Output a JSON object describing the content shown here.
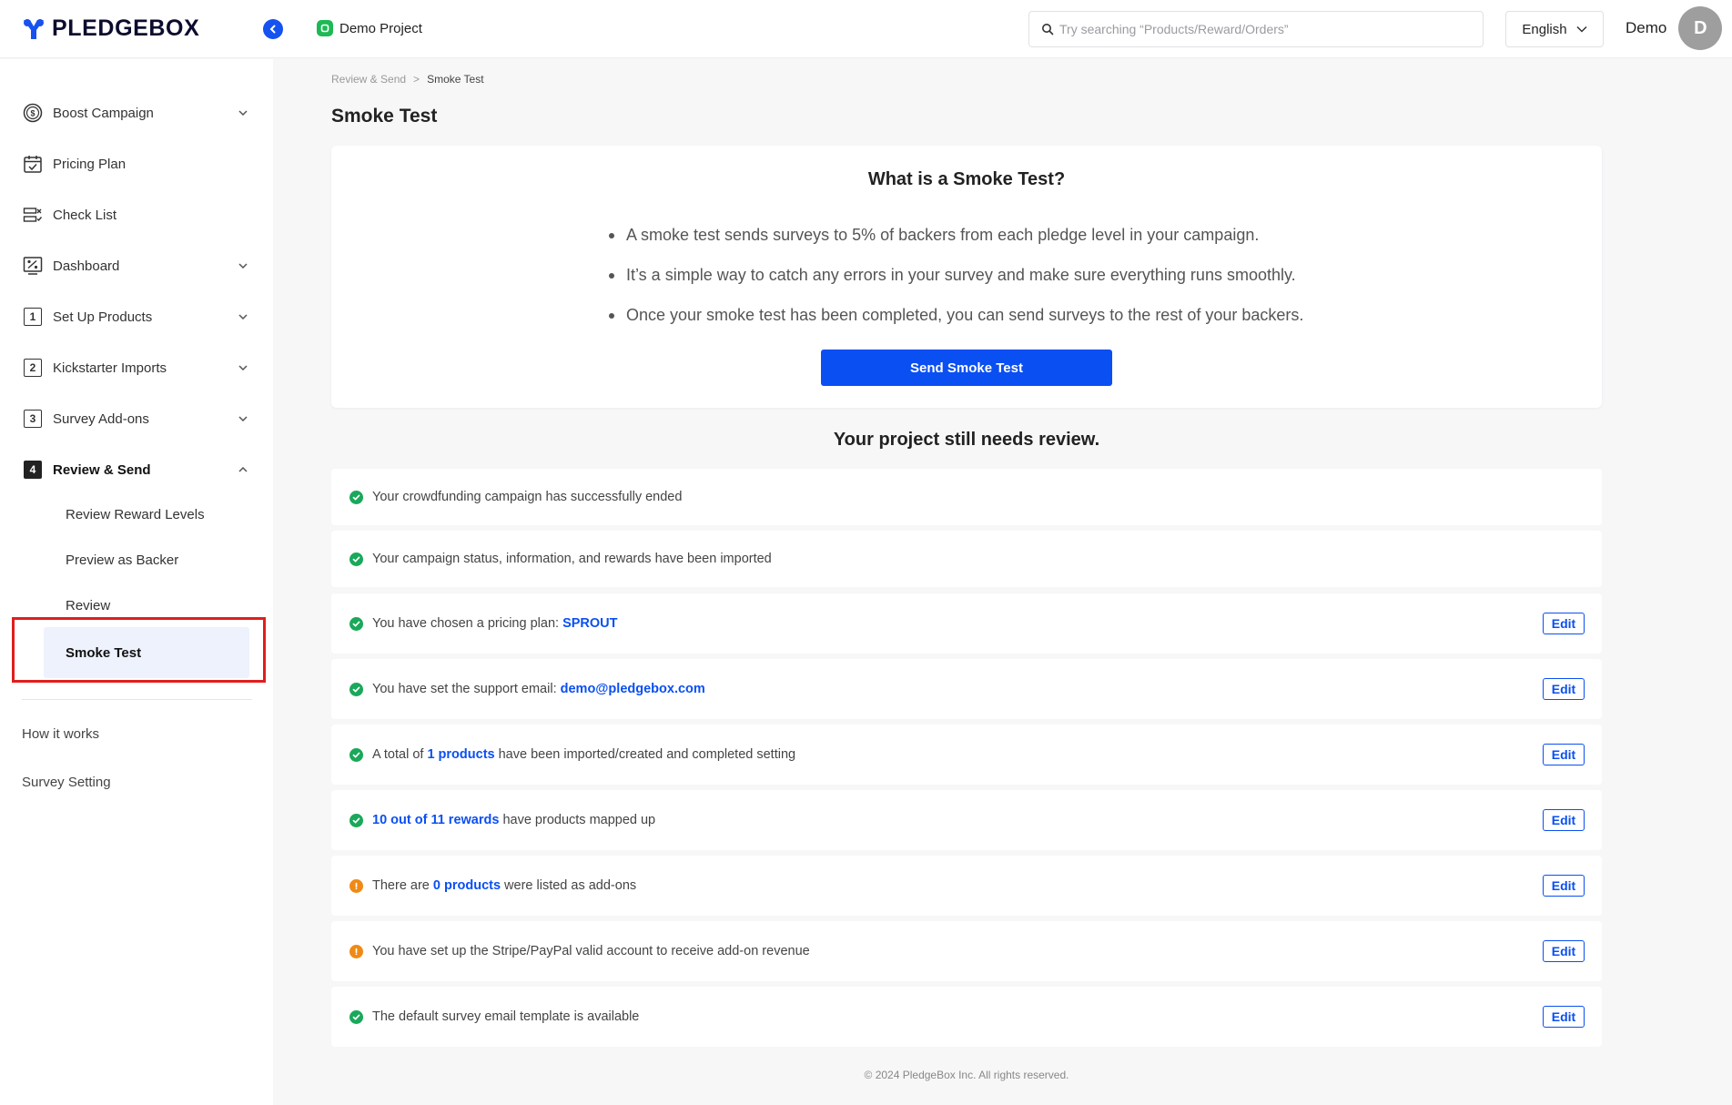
{
  "header": {
    "brand": "PLEDGEBOX",
    "project_name": "Demo Project",
    "search_placeholder": "Try searching “Products/Reward/Orders”",
    "language": "English",
    "user_name": "Demo",
    "avatar_initial": "D"
  },
  "sidebar": {
    "items": [
      {
        "label": "Boost Campaign",
        "icon": "dollar-circle-icon",
        "expandable": true
      },
      {
        "label": "Pricing Plan",
        "icon": "calendar-icon",
        "expandable": false
      },
      {
        "label": "Check List",
        "icon": "checklist-icon",
        "expandable": false
      },
      {
        "label": "Dashboard",
        "icon": "percent-chart-icon",
        "expandable": true
      },
      {
        "label": "Set Up Products",
        "icon": "step-1-icon",
        "step": "1",
        "expandable": true
      },
      {
        "label": "Kickstarter Imports",
        "icon": "step-2-icon",
        "step": "2",
        "expandable": true
      },
      {
        "label": "Survey Add-ons",
        "icon": "step-3-icon",
        "step": "3",
        "expandable": true
      },
      {
        "label": "Review & Send",
        "icon": "step-4-icon",
        "step": "4",
        "expandable": true,
        "expanded": true
      }
    ],
    "subitems": [
      "Review Reward Levels",
      "Preview as Backer",
      "Review",
      "Smoke Test"
    ],
    "active_subitem": "Smoke Test",
    "links": [
      "How it works",
      "Survey Setting"
    ]
  },
  "breadcrumb": {
    "parent": "Review & Send",
    "separator": ">",
    "current": "Smoke Test"
  },
  "page_title": "Smoke Test",
  "info_card": {
    "title": "What is a Smoke Test?",
    "bullets": [
      "A smoke test sends surveys to 5% of backers from each pledge level in your campaign.",
      "It’s a simple way to catch any errors in your survey and make sure everything runs smoothly.",
      "Once your smoke test has been completed, you can send surveys to the rest of your backers."
    ],
    "button_label": "Send Smoke Test"
  },
  "review": {
    "title": "Your project still needs review.",
    "edit_label": "Edit",
    "rows": [
      {
        "status": "ok",
        "before": "Your crowdfunding campaign has successfully ended",
        "highlight": "",
        "after": "",
        "editable": false
      },
      {
        "status": "ok",
        "before": "Your campaign status, information, and rewards have been imported",
        "highlight": "",
        "after": "",
        "editable": false
      },
      {
        "status": "ok",
        "before": "You have chosen a pricing plan: ",
        "highlight": "SPROUT",
        "after": "",
        "editable": true
      },
      {
        "status": "ok",
        "before": "You have set the support email: ",
        "highlight": "demo@pledgebox.com",
        "after": "",
        "editable": true
      },
      {
        "status": "ok",
        "before": "A total of ",
        "highlight": "1 products",
        "after": " have been imported/created and completed setting",
        "editable": true
      },
      {
        "status": "ok",
        "before": "",
        "highlight": "10 out of 11 rewards",
        "after": " have products mapped up",
        "editable": true
      },
      {
        "status": "warn",
        "before": "There are ",
        "highlight": "0 products",
        "after": " were listed as add-ons",
        "editable": true
      },
      {
        "status": "warn",
        "before": "You have set up the Stripe/PayPal valid account to receive add-on revenue",
        "highlight": "",
        "after": "",
        "editable": true
      },
      {
        "status": "ok",
        "before": "The default survey email template is available",
        "highlight": "",
        "after": "",
        "editable": true
      }
    ]
  },
  "footer": "© 2024 PledgeBox Inc. All rights reserved.",
  "colors": {
    "accent": "#0a4ff2",
    "success": "#1aa85a",
    "warning": "#f08a14",
    "highlight_box": "#e01e1e"
  }
}
